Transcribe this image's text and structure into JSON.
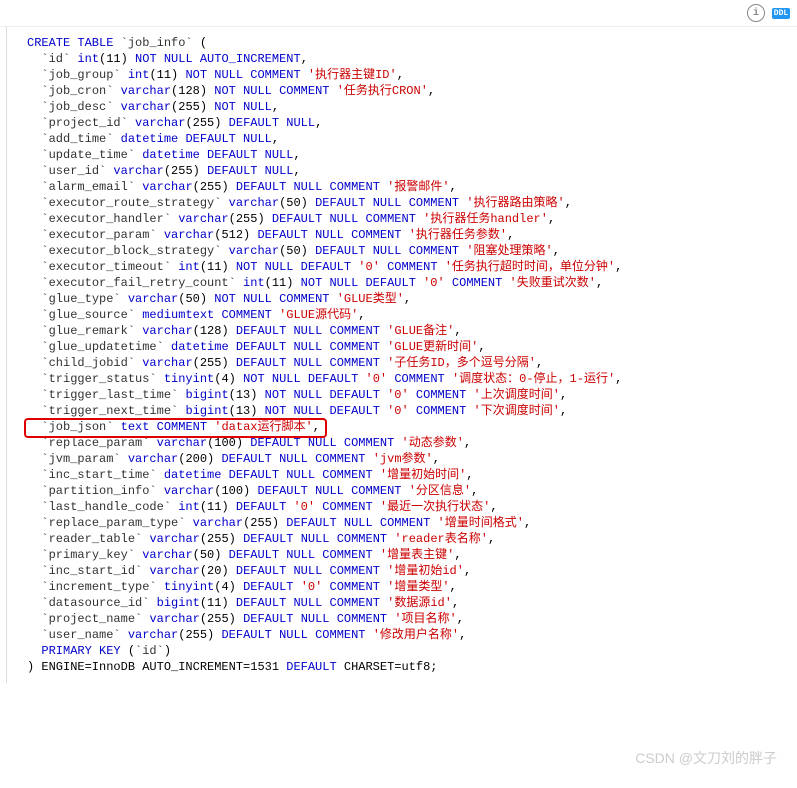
{
  "toolbar": {
    "infoTooltip": "Info",
    "ddlLabel": "DDL"
  },
  "sql": {
    "createStmt": "CREATE TABLE",
    "tableName": "job_info",
    "engine": "InnoDB",
    "autoIncrement": "1531",
    "charset": "utf8",
    "primaryKey": "id",
    "columns": [
      {
        "name": "id",
        "type": "int",
        "len": "11",
        "attrs": "NOT NULL AUTO_INCREMENT",
        "comment": null
      },
      {
        "name": "job_group",
        "type": "int",
        "len": "11",
        "attrs": "NOT NULL",
        "comment": "执行器主键ID"
      },
      {
        "name": "job_cron",
        "type": "varchar",
        "len": "128",
        "attrs": "NOT NULL",
        "comment": "任务执行CRON"
      },
      {
        "name": "job_desc",
        "type": "varchar",
        "len": "255",
        "attrs": "NOT NULL",
        "comment": null
      },
      {
        "name": "project_id",
        "type": "varchar",
        "len": "255",
        "attrs": "DEFAULT NULL",
        "comment": null
      },
      {
        "name": "add_time",
        "type": "datetime",
        "len": null,
        "attrs": "DEFAULT NULL",
        "comment": null
      },
      {
        "name": "update_time",
        "type": "datetime",
        "len": null,
        "attrs": "DEFAULT NULL",
        "comment": null
      },
      {
        "name": "user_id",
        "type": "varchar",
        "len": "255",
        "attrs": "DEFAULT NULL",
        "comment": null
      },
      {
        "name": "alarm_email",
        "type": "varchar",
        "len": "255",
        "attrs": "DEFAULT NULL",
        "comment": "报警邮件"
      },
      {
        "name": "executor_route_strategy",
        "type": "varchar",
        "len": "50",
        "attrs": "DEFAULT NULL",
        "comment": "执行器路由策略"
      },
      {
        "name": "executor_handler",
        "type": "varchar",
        "len": "255",
        "attrs": "DEFAULT NULL",
        "comment": "执行器任务handler"
      },
      {
        "name": "executor_param",
        "type": "varchar",
        "len": "512",
        "attrs": "DEFAULT NULL",
        "comment": "执行器任务参数"
      },
      {
        "name": "executor_block_strategy",
        "type": "varchar",
        "len": "50",
        "attrs": "DEFAULT NULL",
        "comment": "阻塞处理策略"
      },
      {
        "name": "executor_timeout",
        "type": "int",
        "len": "11",
        "attrs": "NOT NULL DEFAULT '0'",
        "comment": "任务执行超时时间，单位分钟"
      },
      {
        "name": "executor_fail_retry_count",
        "type": "int",
        "len": "11",
        "attrs": "NOT NULL DEFAULT '0'",
        "comment": "失败重试次数"
      },
      {
        "name": "glue_type",
        "type": "varchar",
        "len": "50",
        "attrs": "NOT NULL",
        "comment": "GLUE类型"
      },
      {
        "name": "glue_source",
        "type": "mediumtext",
        "len": null,
        "attrs": "",
        "comment": "GLUE源代码"
      },
      {
        "name": "glue_remark",
        "type": "varchar",
        "len": "128",
        "attrs": "DEFAULT NULL",
        "comment": "GLUE备注"
      },
      {
        "name": "glue_updatetime",
        "type": "datetime",
        "len": null,
        "attrs": "DEFAULT NULL",
        "comment": "GLUE更新时间"
      },
      {
        "name": "child_jobid",
        "type": "varchar",
        "len": "255",
        "attrs": "DEFAULT NULL",
        "comment": "子任务ID，多个逗号分隔"
      },
      {
        "name": "trigger_status",
        "type": "tinyint",
        "len": "4",
        "attrs": "NOT NULL DEFAULT '0'",
        "comment": "调度状态：0-停止，1-运行"
      },
      {
        "name": "trigger_last_time",
        "type": "bigint",
        "len": "13",
        "attrs": "NOT NULL DEFAULT '0'",
        "comment": "上次调度时间"
      },
      {
        "name": "trigger_next_time",
        "type": "bigint",
        "len": "13",
        "attrs": "NOT NULL DEFAULT '0'",
        "comment": "下次调度时间"
      },
      {
        "name": "job_json",
        "type": "text",
        "len": null,
        "attrs": "",
        "comment": "datax运行脚本",
        "highlight": true
      },
      {
        "name": "replace_param",
        "type": "varchar",
        "len": "100",
        "attrs": "DEFAULT NULL",
        "comment": "动态参数"
      },
      {
        "name": "jvm_param",
        "type": "varchar",
        "len": "200",
        "attrs": "DEFAULT NULL",
        "comment": "jvm参数"
      },
      {
        "name": "inc_start_time",
        "type": "datetime",
        "len": null,
        "attrs": "DEFAULT NULL",
        "comment": "增量初始时间"
      },
      {
        "name": "partition_info",
        "type": "varchar",
        "len": "100",
        "attrs": "DEFAULT NULL",
        "comment": "分区信息"
      },
      {
        "name": "last_handle_code",
        "type": "int",
        "len": "11",
        "attrs": "DEFAULT '0'",
        "comment": "最近一次执行状态"
      },
      {
        "name": "replace_param_type",
        "type": "varchar",
        "len": "255",
        "attrs": "DEFAULT NULL",
        "comment": "增量时间格式"
      },
      {
        "name": "reader_table",
        "type": "varchar",
        "len": "255",
        "attrs": "DEFAULT NULL",
        "comment": "reader表名称"
      },
      {
        "name": "primary_key",
        "type": "varchar",
        "len": "50",
        "attrs": "DEFAULT NULL",
        "comment": "增量表主键"
      },
      {
        "name": "inc_start_id",
        "type": "varchar",
        "len": "20",
        "attrs": "DEFAULT NULL",
        "comment": "增量初始id"
      },
      {
        "name": "increment_type",
        "type": "tinyint",
        "len": "4",
        "attrs": "DEFAULT '0'",
        "comment": "增量类型"
      },
      {
        "name": "datasource_id",
        "type": "bigint",
        "len": "11",
        "attrs": "DEFAULT NULL",
        "comment": "数据源id"
      },
      {
        "name": "project_name",
        "type": "varchar",
        "len": "255",
        "attrs": "DEFAULT NULL",
        "comment": "项目名称"
      },
      {
        "name": "user_name",
        "type": "varchar",
        "len": "255",
        "attrs": "DEFAULT NULL",
        "comment": "修改用户名称"
      }
    ]
  },
  "watermark": "CSDN @文刀刘的胖子"
}
